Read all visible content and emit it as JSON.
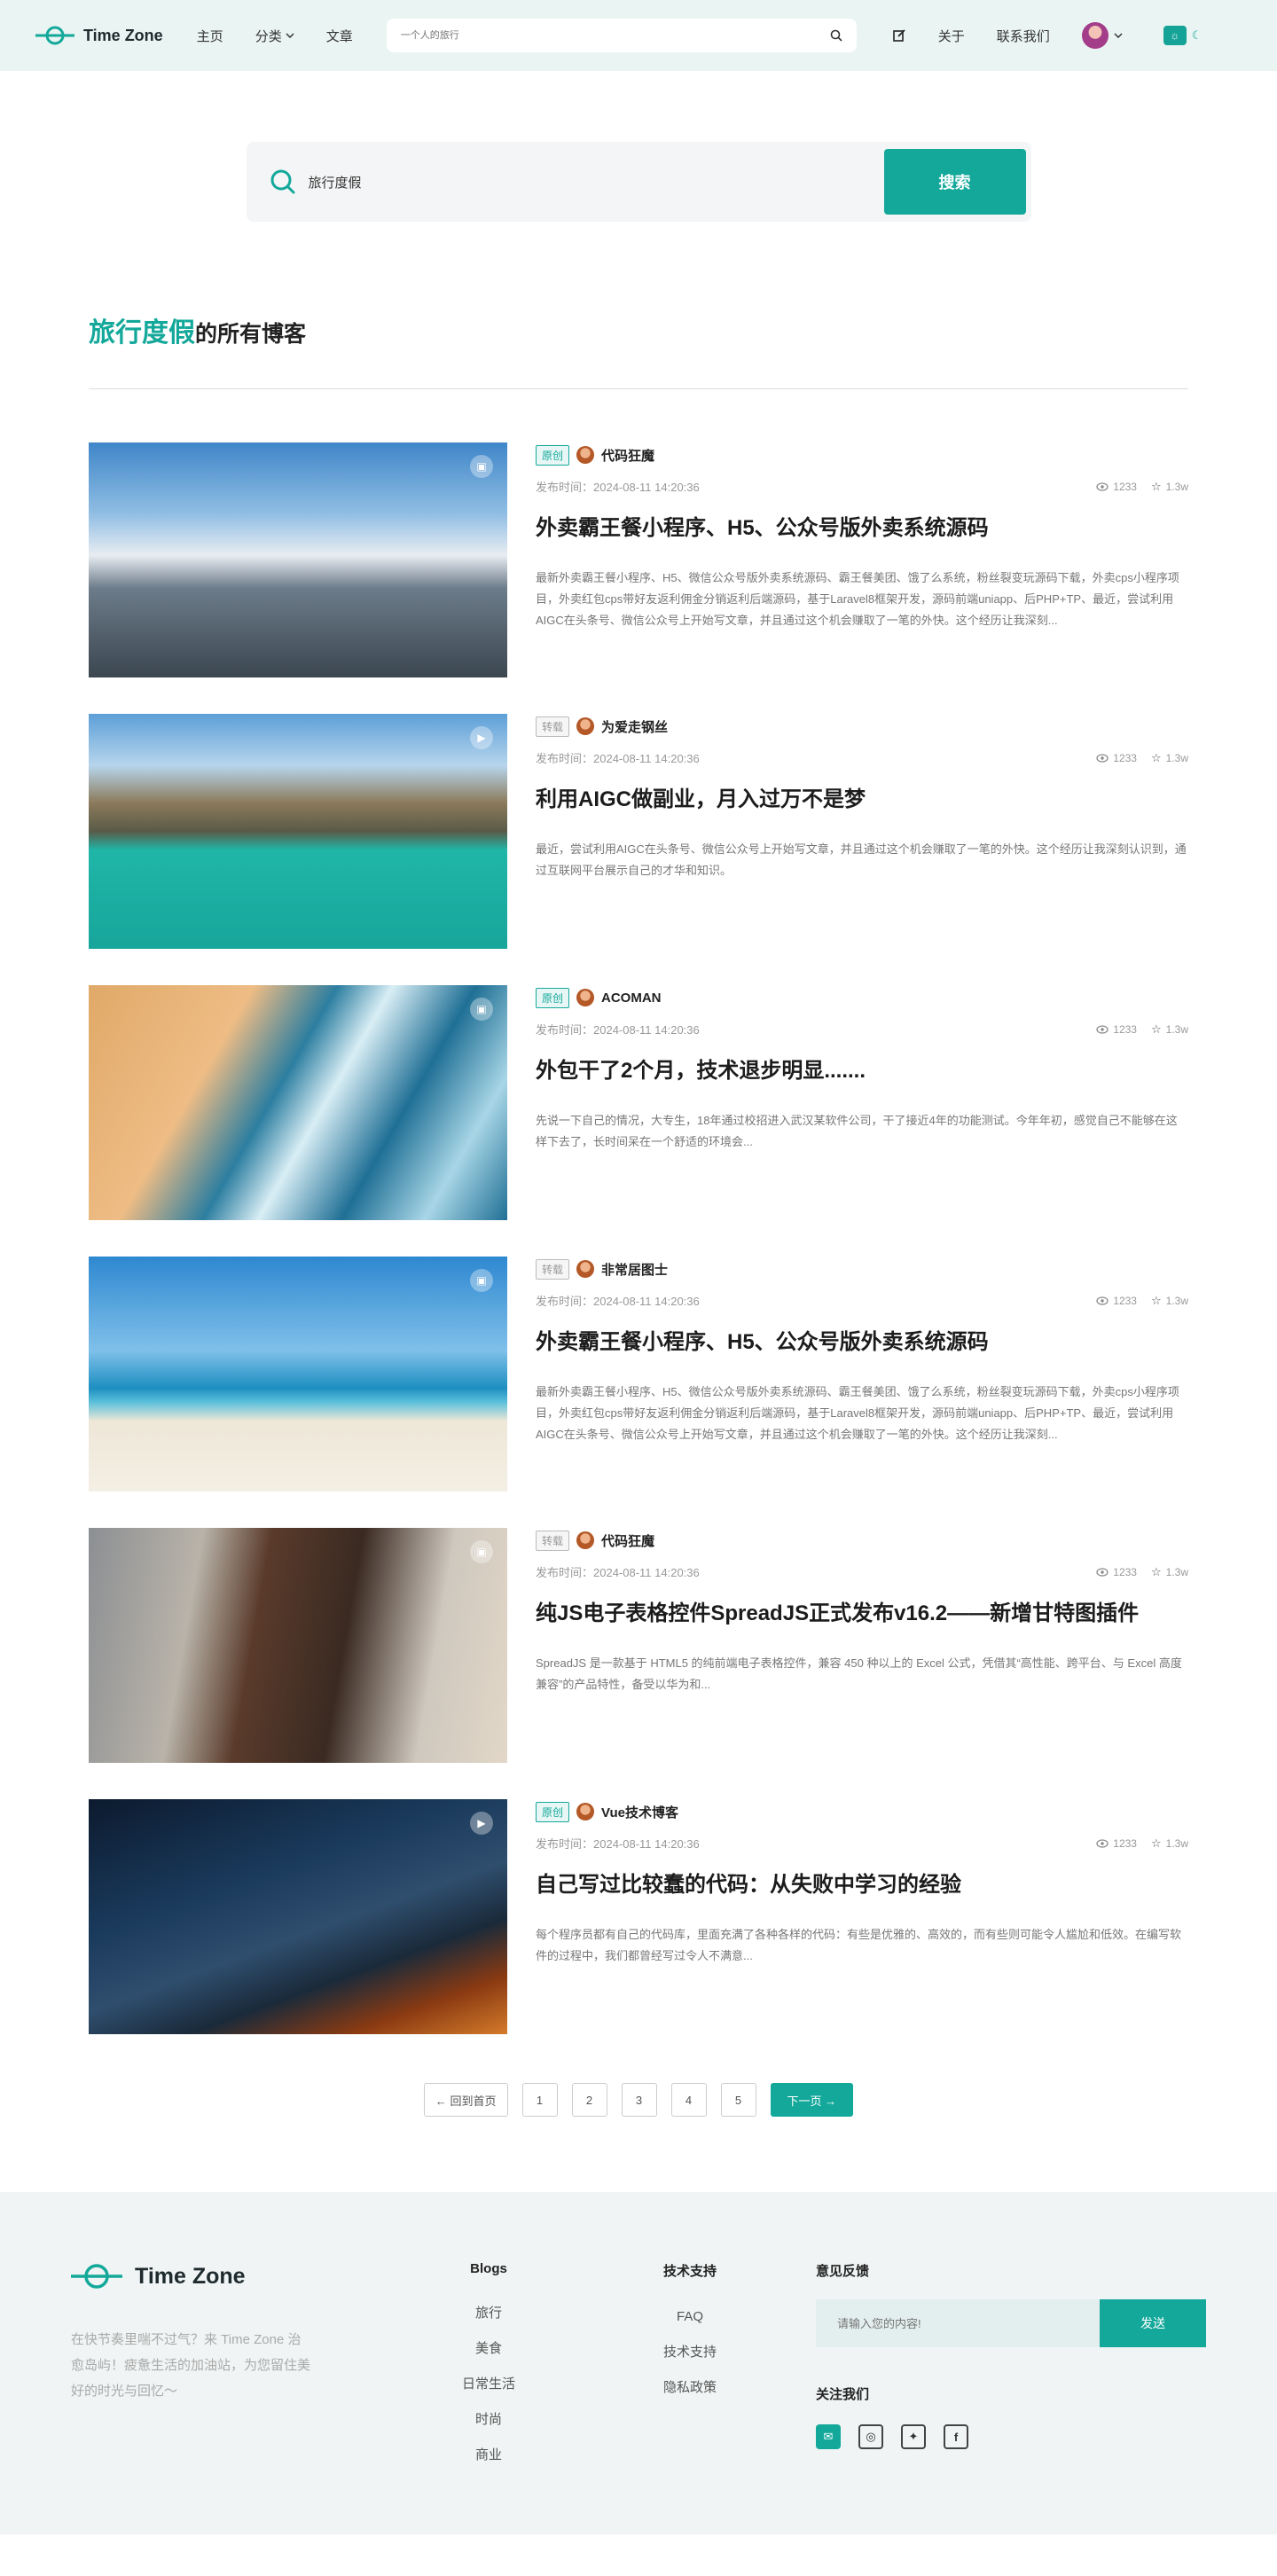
{
  "header": {
    "logo": "Time Zone",
    "nav": [
      "主页",
      "分类",
      "文章"
    ],
    "search_placeholder": "一个人的旅行",
    "about": "关于",
    "contact": "联系我们"
  },
  "search": {
    "value": "旅行度假",
    "button": "搜索"
  },
  "results": {
    "keyword": "旅行度假",
    "suffix": "的所有博客"
  },
  "posts": [
    {
      "badge": "原创",
      "author": "代码狂魔",
      "date": "发布时间：2024-08-11 14:20:36",
      "views": "1233",
      "stars": "1.3w",
      "title": "外卖霸王餐小程序、H5、公众号版外卖系统源码",
      "excerpt": "最新外卖霸王餐小程序、H5、微信公众号版外卖系统源码、霸王餐美团、饿了么系统，粉丝裂变玩源码下载，外卖cps小程序项目，外卖红包cps带好友返利佣金分销返利后端源码，基于Laravel8框架开发，源码前端uniapp、后PHP+TP、最近，尝试利用AIGC在头条号、微信公众号上开始写文章，并且通过这个机会赚取了一笔的外快。这个经历让我深刻..."
    },
    {
      "badge": "转载",
      "author": "为爱走钢丝",
      "date": "发布时间：2024-08-11 14:20:36",
      "views": "1233",
      "stars": "1.3w",
      "title": "利用AIGC做副业，月入过万不是梦",
      "excerpt": "最近，尝试利用AIGC在头条号、微信公众号上开始写文章，并且通过这个机会赚取了一笔的外快。这个经历让我深刻认识到，通过互联网平台展示自己的才华和知识。"
    },
    {
      "badge": "原创",
      "author": "ACOMAN",
      "date": "发布时间：2024-08-11 14:20:36",
      "views": "1233",
      "stars": "1.3w",
      "title": "外包干了2个月，技术退步明显.......",
      "excerpt": "先说一下自己的情况，大专生，18年通过校招进入武汉某软件公司，干了接近4年的功能测试。今年年初，感觉自己不能够在这样下去了，长时间呆在一个舒适的环境会..."
    },
    {
      "badge": "转载",
      "author": "非常居图士",
      "date": "发布时间：2024-08-11 14:20:36",
      "views": "1233",
      "stars": "1.3w",
      "title": "外卖霸王餐小程序、H5、公众号版外卖系统源码",
      "excerpt": "最新外卖霸王餐小程序、H5、微信公众号版外卖系统源码、霸王餐美团、饿了么系统，粉丝裂变玩源码下载，外卖cps小程序项目，外卖红包cps带好友返利佣金分销返利后端源码，基于Laravel8框架开发，源码前端uniapp、后PHP+TP、最近，尝试利用AIGC在头条号、微信公众号上开始写文章，并且通过这个机会赚取了一笔的外快。这个经历让我深刻..."
    },
    {
      "badge": "转载",
      "author": "代码狂魔",
      "date": "发布时间：2024-08-11 14:20:36",
      "views": "1233",
      "stars": "1.3w",
      "title": "纯JS电子表格控件SpreadJS正式发布v16.2——新增甘特图插件",
      "excerpt": "SpreadJS 是一款基于 HTML5 的纯前端电子表格控件，兼容 450 种以上的 Excel 公式，凭借其“高性能、跨平台、与 Excel 高度兼容”的产品特性，备受以华为和..."
    },
    {
      "badge": "原创",
      "author": "Vue技术博客",
      "date": "发布时间：2024-08-11 14:20:36",
      "views": "1233",
      "stars": "1.3w",
      "title": "自己写过比较蠢的代码：从失败中学习的经验",
      "excerpt": "每个程序员都有自己的代码库，里面充满了各种各样的代码：有些是优雅的、高效的，而有些则可能令人尴尬和低效。在编写软件的过程中，我们都曾经写过令人不满意..."
    }
  ],
  "pagination": {
    "home": "← 回到首页",
    "pages": [
      "1",
      "2",
      "3",
      "4",
      "5"
    ],
    "next": "下一页 →"
  },
  "footer": {
    "logo": "Time Zone",
    "desc": "在快节奏里喘不过气？来 Time Zone 治愈岛屿！疲惫生活的加油站，为您留住美好的时光与回忆～",
    "blogs_title": "Blogs",
    "blogs": [
      "旅行",
      "美食",
      "日常生活",
      "时尚",
      "商业"
    ],
    "tech_title": "技术支持",
    "tech": [
      "FAQ",
      "技术支持",
      "隐私政策"
    ],
    "feedback_title": "意见反馈",
    "feedback_placeholder": "请输入您的内容!",
    "feedback_button": "发送",
    "follow_title": "关注我们"
  },
  "colors": {
    "accent": "#13a89a",
    "header_bg": "#eaf4f3",
    "footer_bg": "#f0f4f4"
  }
}
